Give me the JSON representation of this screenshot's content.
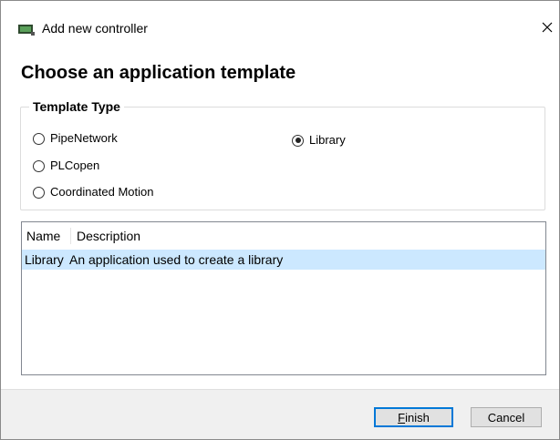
{
  "window": {
    "title": "Add new controller",
    "icon": "controller-icon",
    "close_glyph": "✕"
  },
  "heading": "Choose an application template",
  "template_type": {
    "legend": "Template Type",
    "options": [
      {
        "label": "PipeNetwork",
        "checked": false
      },
      {
        "label": "PLCopen",
        "checked": false
      },
      {
        "label": "Coordinated Motion",
        "checked": false
      },
      {
        "label": "Library",
        "checked": true
      }
    ]
  },
  "template_list": {
    "columns": [
      "Name",
      "Description"
    ],
    "rows": [
      {
        "name": "Library",
        "description": "An application used to create a library",
        "selected": true
      }
    ],
    "selection_color": "#cce8ff"
  },
  "buttons": {
    "finish_first": "F",
    "finish_rest": "inish",
    "cancel": "Cancel"
  },
  "colors": {
    "accent": "#0078d7",
    "footer_bg": "#f0f0f0"
  }
}
